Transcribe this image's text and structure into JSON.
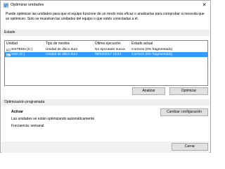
{
  "window": {
    "title": "Optimizar unidades",
    "close_glyph": "✕"
  },
  "description": "Puede optimizar las unidades para que el equipo funcione de un modo más eficaz o analizarlas para comprobar si necesita que se optimicen. Solo se muestran las unidades del equipo o que estén conectadas a él.",
  "status": {
    "label": "Estado",
    "columns": [
      "Unidad",
      "Tipo de medios",
      "Última ejecución",
      "Estado actual"
    ],
    "rows": [
      {
        "drive": "SISTEMA (C:)",
        "media": "Unidad de disco duro",
        "last_run": "No ejecutado nunca",
        "state": "Correcto (0% fragmentado)",
        "selected": false
      },
      {
        "drive": "SSD (D:)",
        "media": "Unidad de disco duro",
        "last_run": "08/02/2017 15:44",
        "state": "Correcto (0% fragmentado)",
        "selected": true
      }
    ],
    "analyze_label": "Analizar",
    "optimize_label": "Optimizar"
  },
  "schedule": {
    "label": "Optimización programada",
    "state": "Activar",
    "line1": "Las unidades se están optimizando automáticamente.",
    "line2": "Frecuencia: semanal",
    "change_label": "Cambiar configuración"
  },
  "footer": {
    "close_label": "Cerrar"
  },
  "colors": {
    "selection": "#3399ff",
    "band": "#f0f0f0"
  }
}
